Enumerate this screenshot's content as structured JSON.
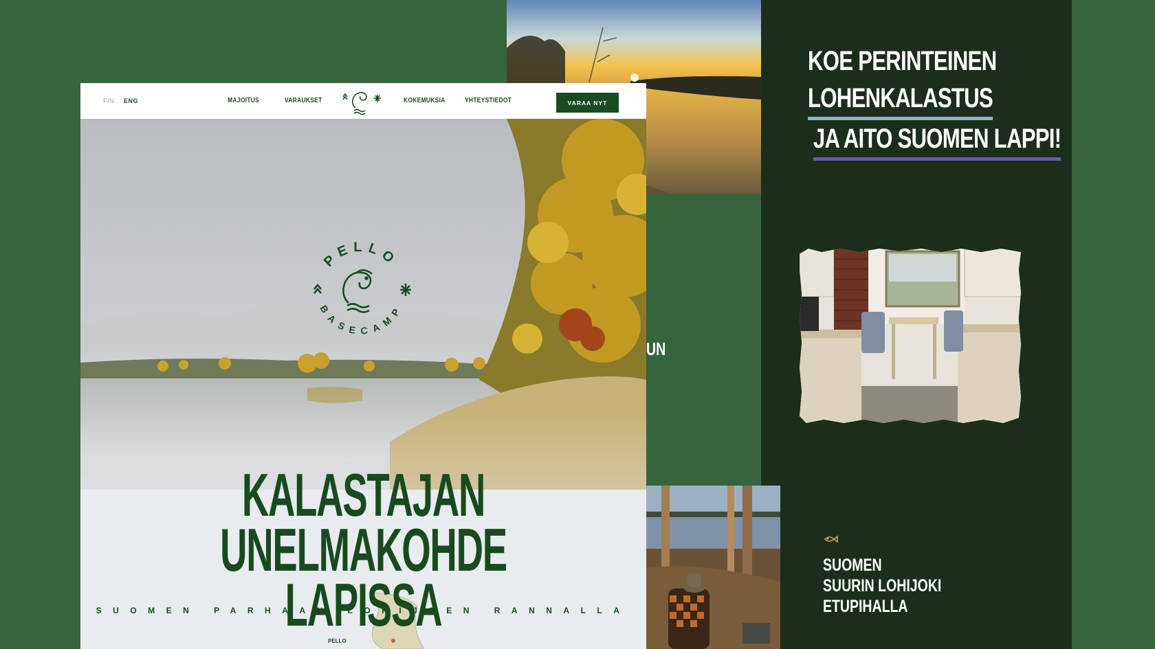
{
  "site": {
    "nav": {
      "lang_fin": "FIN",
      "lang_eng": "ENG",
      "links": [
        "MAJOITUS",
        "VARAUKSET",
        "KOKEMUKSIA",
        "YHTEYSTIEDOT"
      ],
      "cta": "VARAA NYT"
    },
    "hero": {
      "logo_top": "PELLO",
      "logo_bottom": "BASECAMP",
      "title_lines": [
        "KALASTAJAN",
        "UNELMAKOHDE",
        "LAPISSA"
      ],
      "tagline": "SUOMEN PARHAAN LOHIJOEN RANNALLA",
      "map_label": "PELLO"
    }
  },
  "middle": {
    "fragment_text": "UN"
  },
  "panel": {
    "headline_lines": [
      "KOE PERINTEINEN",
      "LOHENKALASTUS",
      "JA AITO SUOMEN LAPPI!"
    ],
    "feature_lines": [
      "SUOMEN",
      "SUURIN LOHIJOKI",
      "ETUPIHALLA"
    ]
  },
  "colors": {
    "background": "#36643d",
    "panel": "#1b2e1b",
    "brand_green": "#1c4a22",
    "underline_blue": "#8ab6c8",
    "underline_purple": "#6b5aa8",
    "accent_gold": "#c7b24a"
  },
  "icons": [
    "fish-logo-icon",
    "tree-icon",
    "star-icon",
    "fish-outline-icon"
  ]
}
